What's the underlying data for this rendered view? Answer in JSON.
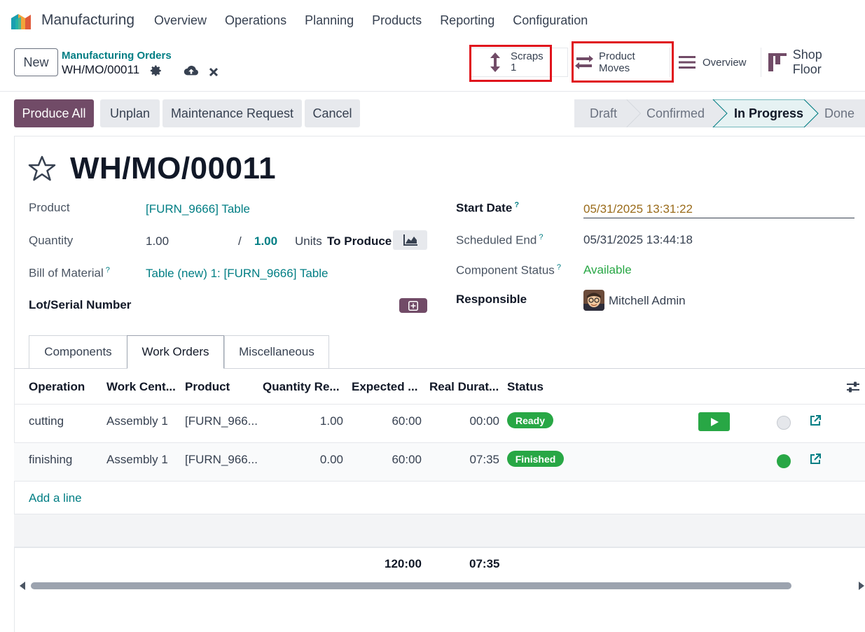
{
  "navbar": {
    "app_name": "Manufacturing",
    "menu": [
      "Overview",
      "Operations",
      "Planning",
      "Products",
      "Reporting",
      "Configuration"
    ]
  },
  "control_panel": {
    "new_label": "New",
    "breadcrumb_parent": "Manufacturing Orders",
    "breadcrumb_current": "WH/MO/00011",
    "smart_buttons": {
      "scraps_label": "Scraps",
      "scraps_count": "1",
      "moves_label": "Product Moves",
      "overview_label": "Overview",
      "shop_floor_label": "Shop Floor"
    }
  },
  "actions": {
    "produce_all": "Produce All",
    "unplan": "Unplan",
    "maintenance": "Maintenance Request",
    "cancel": "Cancel"
  },
  "status_stages": [
    "Draft",
    "Confirmed",
    "In Progress",
    "Done"
  ],
  "active_stage": "In Progress",
  "record": {
    "title": "WH/MO/00011",
    "product_label": "Product",
    "product_value": "[FURN_9666] Table",
    "quantity_label": "Quantity",
    "quantity_value": "1.00",
    "quantity_sep": "/",
    "quantity_total": "1.00",
    "units_label": "Units",
    "to_produce_label": "To Produce",
    "bom_label": "Bill of Material",
    "bom_value": "Table (new) 1: [FURN_9666] Table",
    "lot_label": "Lot/Serial Number",
    "start_date_label": "Start Date",
    "start_date_value": "05/31/2025 13:31:22",
    "scheduled_end_label": "Scheduled End",
    "scheduled_end_value": "05/31/2025 13:44:18",
    "component_status_label": "Component Status",
    "component_status_value": "Available",
    "responsible_label": "Responsible",
    "responsible_value": "Mitchell Admin",
    "help_mark": "?"
  },
  "tabs": [
    "Components",
    "Work Orders",
    "Miscellaneous"
  ],
  "active_tab": "Work Orders",
  "table": {
    "headers": [
      "Operation",
      "Work Cent...",
      "Product",
      "Quantity Re...",
      "Expected ...",
      "Real Durat...",
      "Status"
    ],
    "rows": [
      {
        "operation": "cutting",
        "work_center": "Assembly 1",
        "product": "[FURN_966...",
        "quantity": "1.00",
        "expected": "60:00",
        "real": "00:00",
        "status": "Ready"
      },
      {
        "operation": "finishing",
        "work_center": "Assembly 1",
        "product": "[FURN_966...",
        "quantity": "0.00",
        "expected": "60:00",
        "real": "07:35",
        "status": "Finished"
      }
    ],
    "add_line": "Add a line",
    "total_expected": "120:00",
    "total_real": "07:35"
  },
  "colors": {
    "primary": "#714b67",
    "link": "#017e84",
    "success": "#28a745",
    "highlight": "#e0141c",
    "date_warning": "#9a6b1a"
  }
}
